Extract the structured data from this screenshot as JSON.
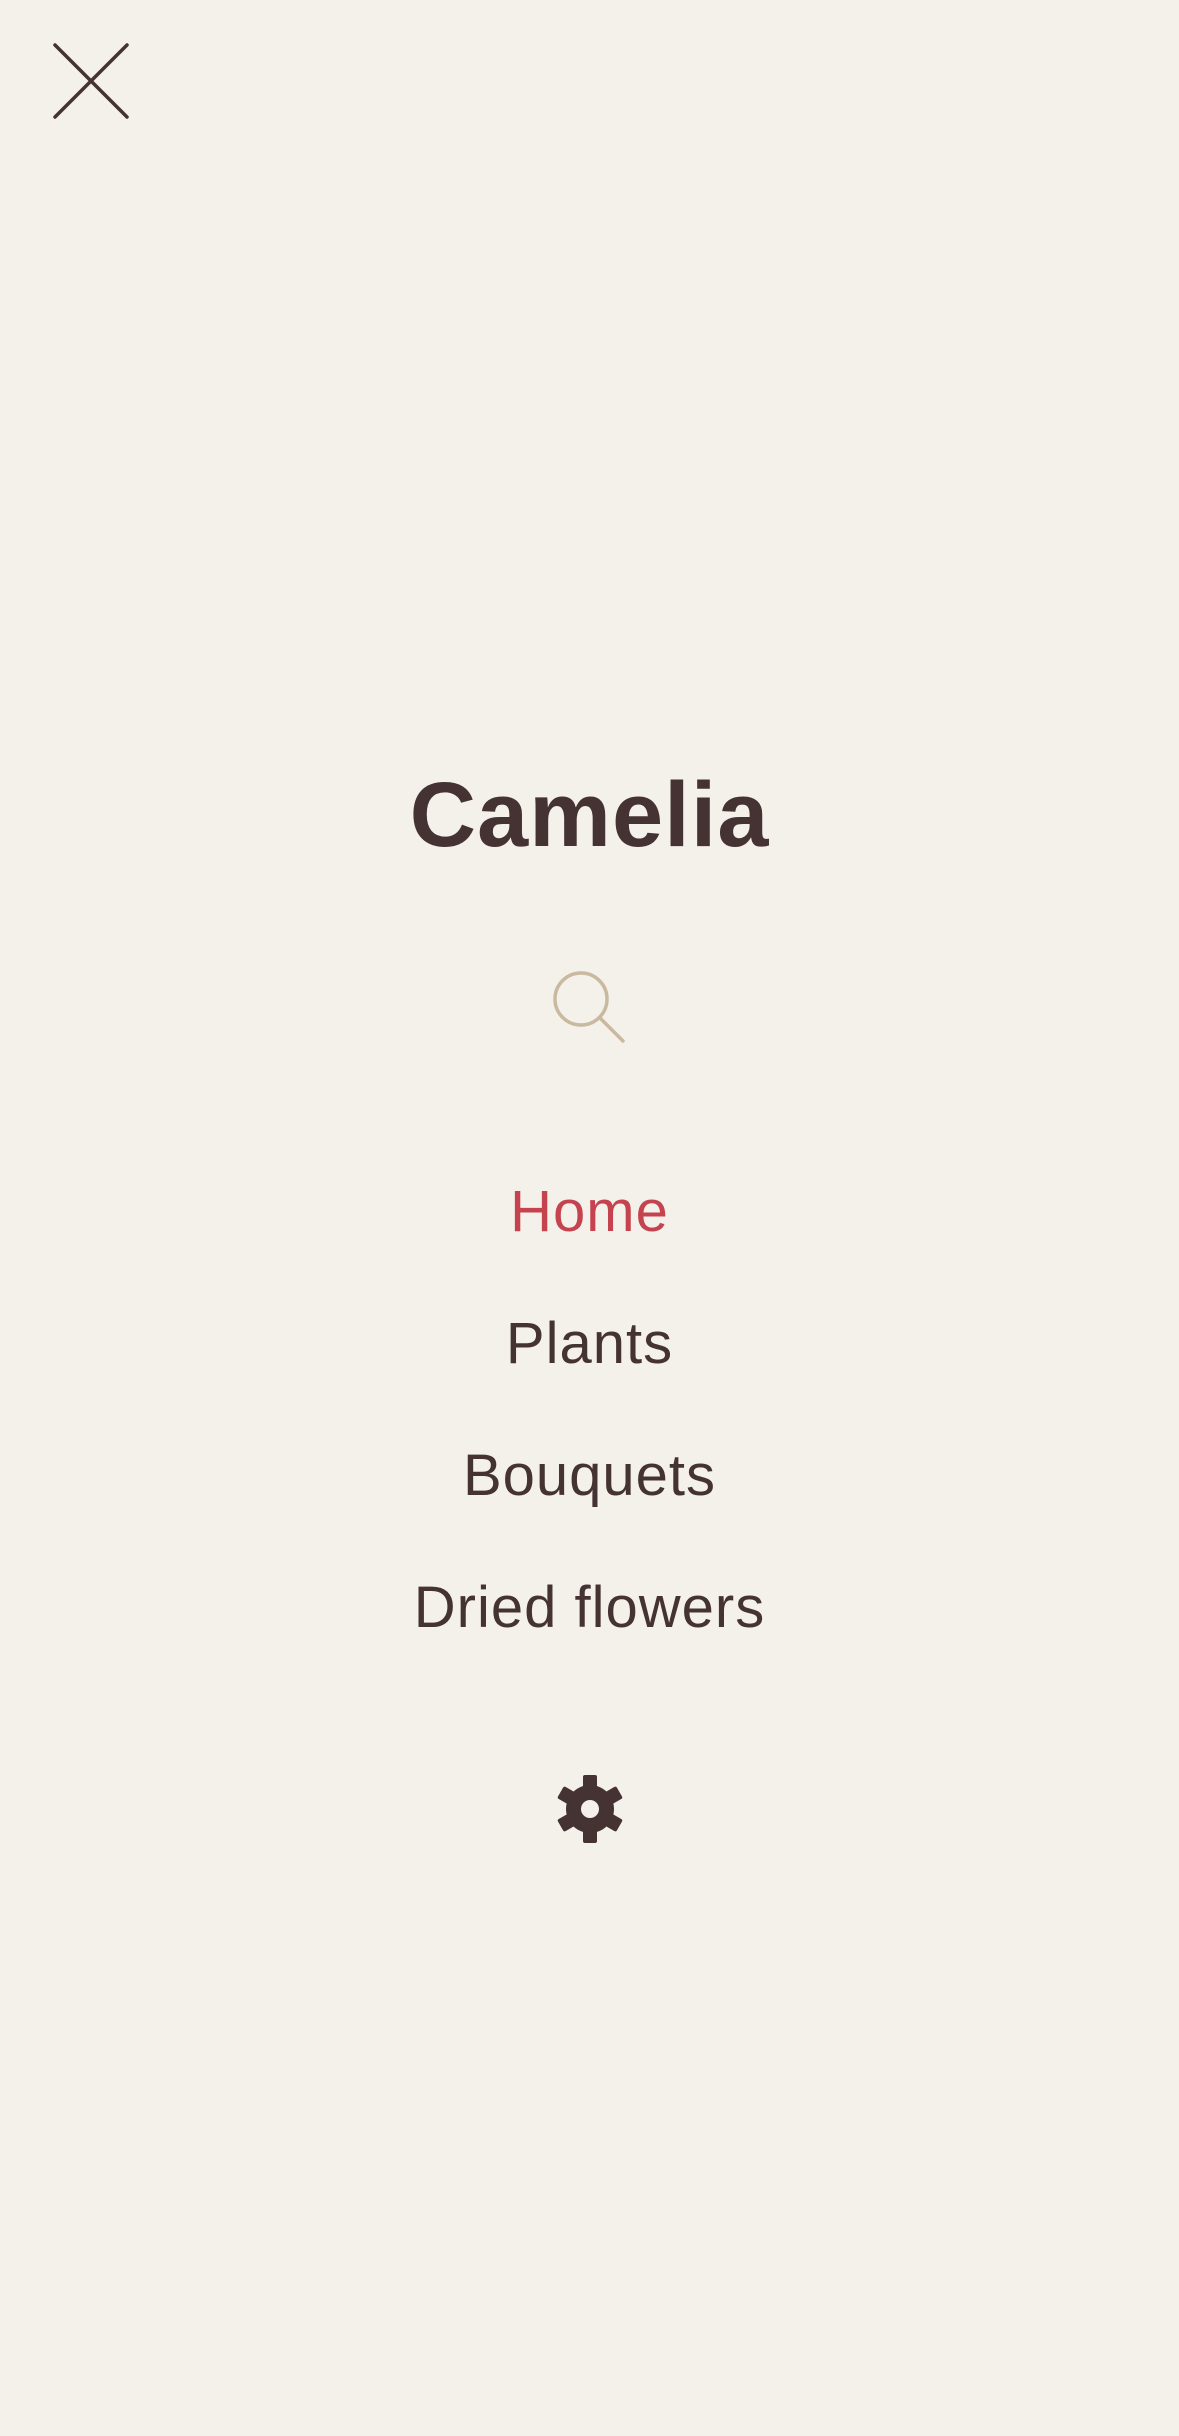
{
  "header": {
    "close_icon": "close-icon"
  },
  "brand": {
    "title": "Camelia"
  },
  "search": {
    "icon": "search-icon",
    "icon_color": "#c9b9a1"
  },
  "nav": {
    "items": [
      {
        "label": "Home",
        "active": true
      },
      {
        "label": "Plants",
        "active": false
      },
      {
        "label": "Bouquets",
        "active": false
      },
      {
        "label": "Dried flowers",
        "active": false
      }
    ]
  },
  "settings": {
    "icon": "gear-icon"
  },
  "colors": {
    "background": "#f4f0ea",
    "text": "#453334",
    "accent": "#c5434f",
    "search_icon": "#c9b9a1"
  }
}
